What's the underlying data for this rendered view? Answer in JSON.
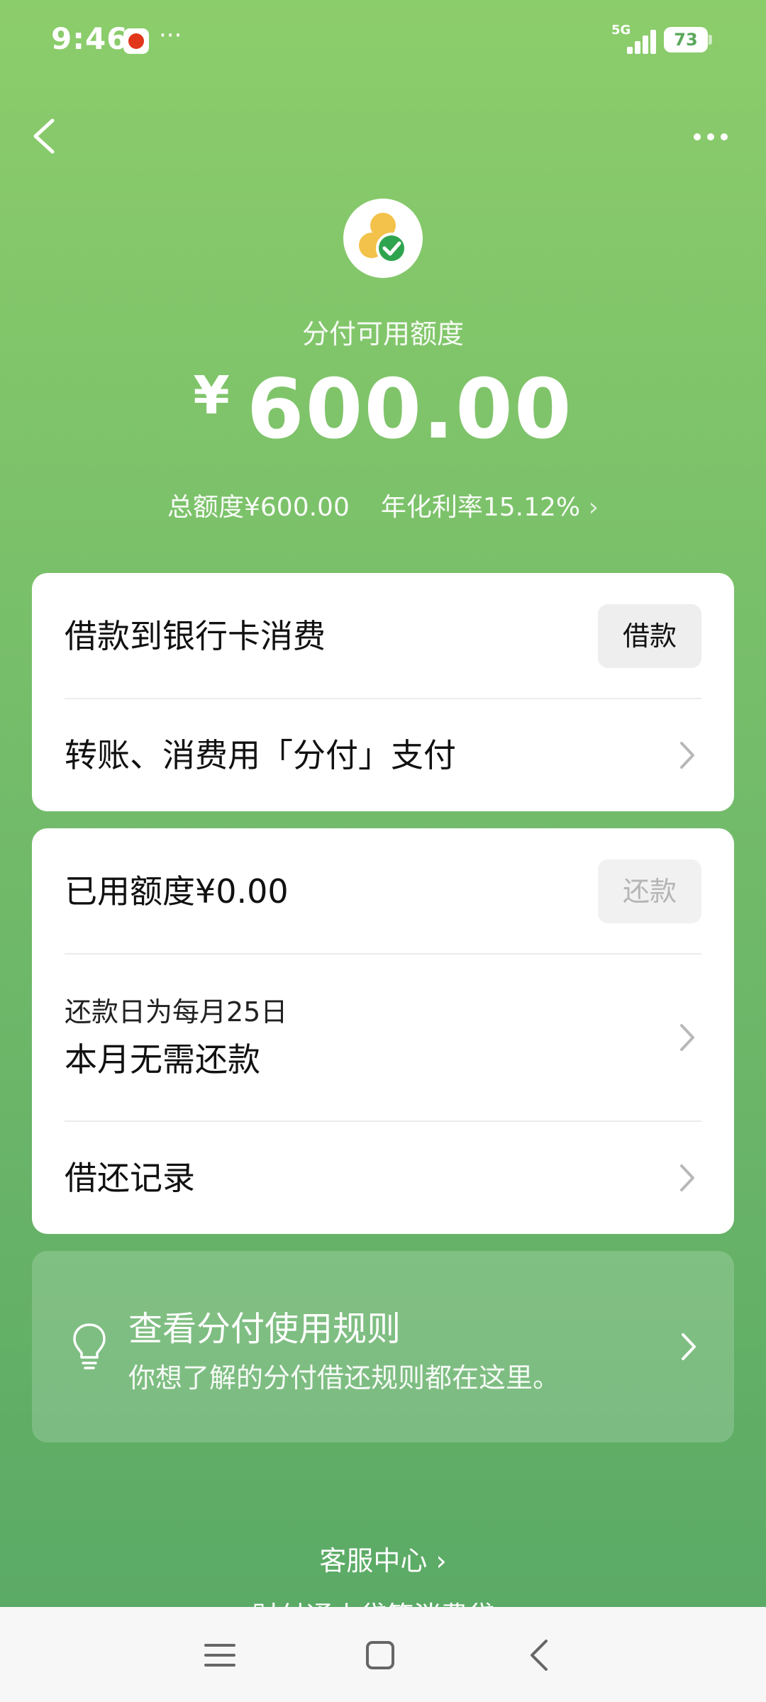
{
  "status": {
    "time": "9:46",
    "more": "···",
    "network": "5G",
    "battery": "73"
  },
  "header": {
    "back_icon": "chevron-left-icon",
    "more_icon": "more-dots-icon"
  },
  "summary": {
    "label": "分付可用额度",
    "currency": "¥",
    "amount": "600.00",
    "total_limit": "总额度¥600.00",
    "annual_rate": "年化利率15.12%",
    "rate_arrow": "›"
  },
  "card1": {
    "borrow_label": "借款到银行卡消费",
    "borrow_button": "借款",
    "pay_label": "转账、消费用「分付」支付"
  },
  "card2": {
    "used_label": "已用额度¥0.00",
    "repay_button": "还款",
    "repay_day": "还款日为每月25日",
    "repay_status": "本月无需还款",
    "records_label": "借还记录"
  },
  "tip": {
    "title": "查看分付使用规则",
    "desc": "你想了解的分付借还规则都在这里。"
  },
  "footer": {
    "service": "客服中心 ›",
    "service2": "财付通小贷等消费贷 ›"
  },
  "colors": {
    "bg_top": "#8ccd6b",
    "bg_bottom": "#58a865",
    "logo_yellow": "#f3c24a",
    "logo_green": "#2fa44f"
  }
}
